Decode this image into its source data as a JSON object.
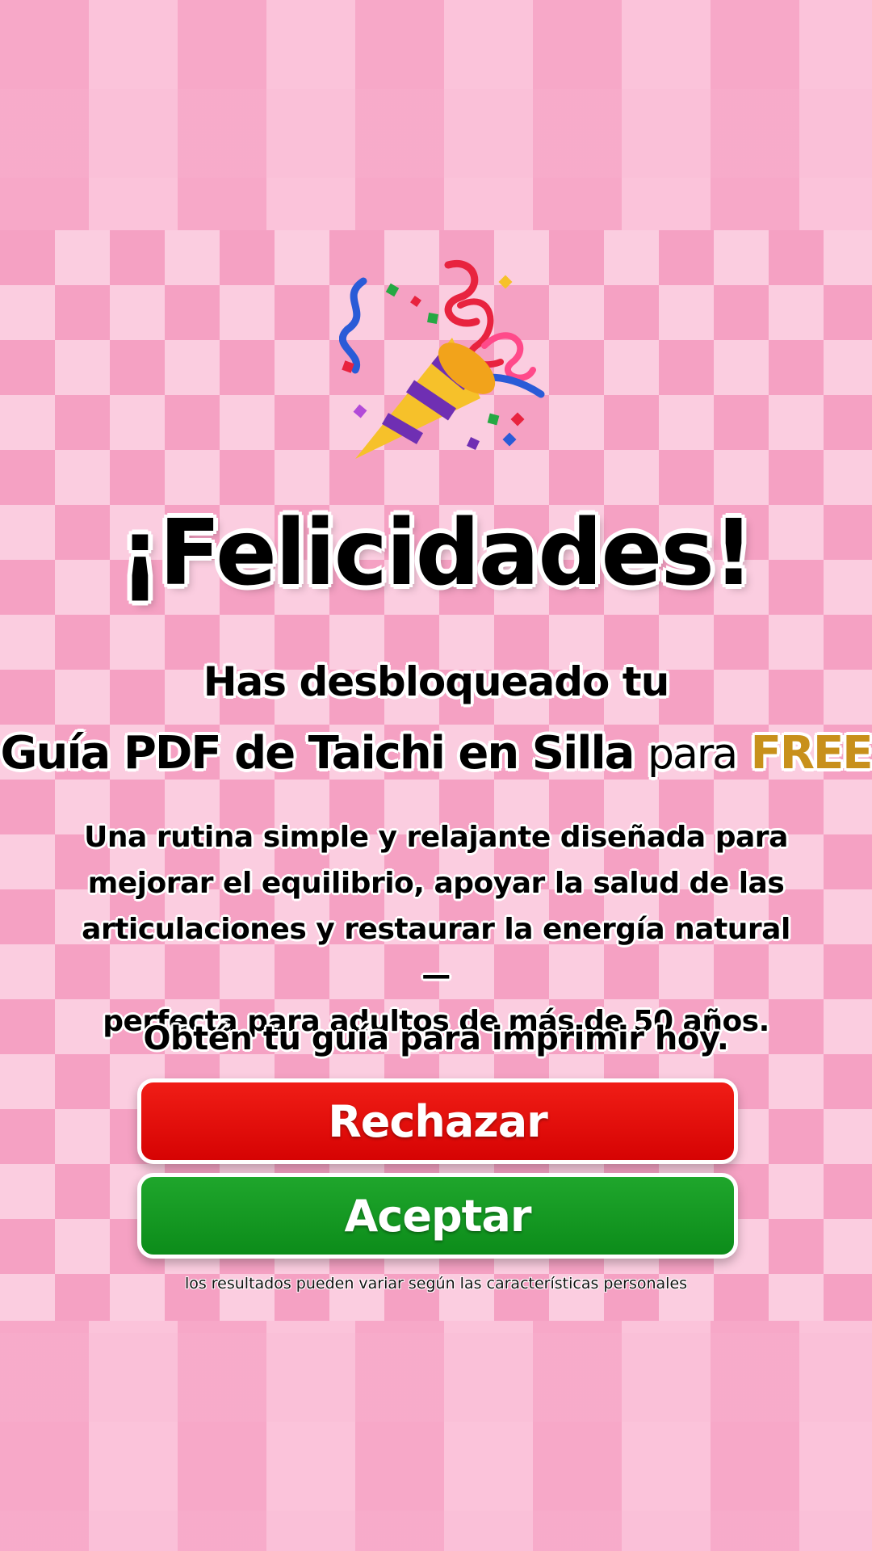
{
  "hero": {
    "icon": "party-popper-icon"
  },
  "headline": "¡Felicidades!",
  "subtitle": {
    "line1": "Has desbloqueado tu",
    "line2_main": "Guía PDF de Taichi en Silla",
    "line2_para": "para",
    "line2_free": "FREE"
  },
  "description": {
    "line1": "Una rutina simple y relajante diseñada para",
    "line2": "mejorar el equilibrio, apoyar la salud de las",
    "line3": "articulaciones y restaurar la energía natural —",
    "line4": "perfecta para adultos de más de 50 años."
  },
  "cta_text": "Obtén tu guía para imprimir hoy.",
  "buttons": {
    "reject_label": "Rechazar",
    "accept_label": "Aceptar"
  },
  "disclaimer": "los resultados pueden variar según las características personales",
  "colors": {
    "background_pink": "#f5a1c3",
    "background_light_pink": "#fbcde0",
    "free_gold": "#c8901b",
    "reject_red": "#e00b08",
    "accept_green": "#149a22"
  }
}
